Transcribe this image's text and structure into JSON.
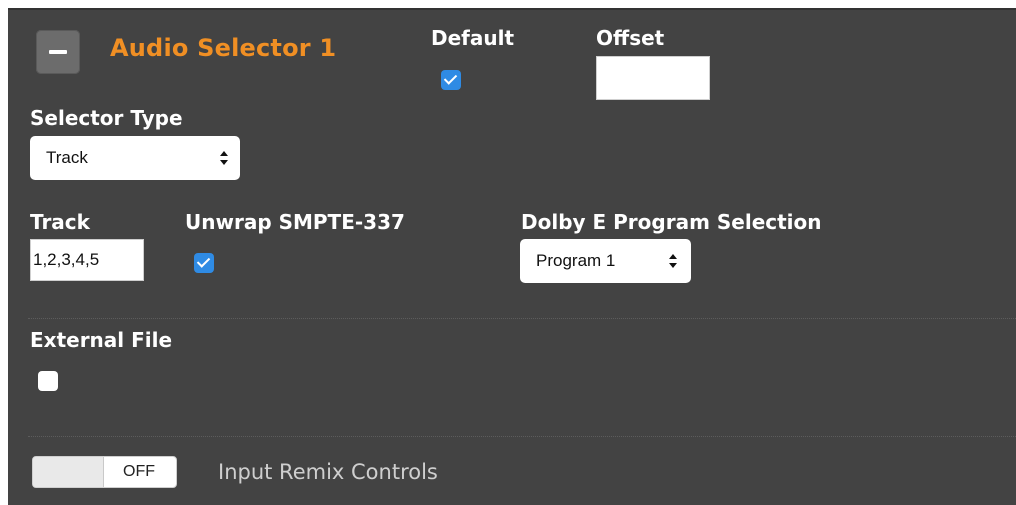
{
  "audio_selector": {
    "title": "Audio Selector 1",
    "default": {
      "label": "Default",
      "checked": true
    },
    "offset": {
      "label": "Offset",
      "value": ""
    },
    "selector_type": {
      "label": "Selector Type",
      "value": "Track"
    },
    "track": {
      "label": "Track",
      "value": "1,2,3,4,5"
    },
    "unwrap_smpte": {
      "label": "Unwrap SMPTE-337",
      "checked": true
    },
    "dolby_e": {
      "label": "Dolby E Program Selection",
      "value": "Program 1"
    },
    "external_file": {
      "label": "External File",
      "checked": false
    },
    "input_remix": {
      "toggle_state": "OFF",
      "label": "Input Remix Controls"
    }
  },
  "icons": {
    "collapse": "minus-icon",
    "select_arrows": "up-down-arrows-icon",
    "checkmark": "checkmark-icon"
  },
  "colors": {
    "panel_bg": "#434343",
    "title_accent": "#f08f24",
    "checkbox_checked": "#2f8be4",
    "toggle_label": "#cfcfcf"
  }
}
